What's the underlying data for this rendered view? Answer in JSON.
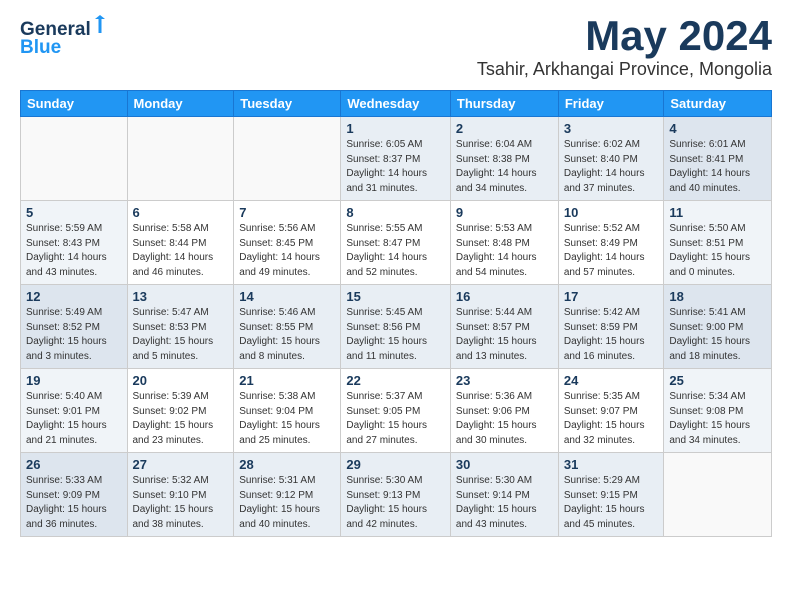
{
  "header": {
    "logo_general": "General",
    "logo_blue": "Blue",
    "month": "May 2024",
    "location": "Tsahir, Arkhangai Province, Mongolia"
  },
  "weekdays": [
    "Sunday",
    "Monday",
    "Tuesday",
    "Wednesday",
    "Thursday",
    "Friday",
    "Saturday"
  ],
  "weeks": [
    [
      {
        "day": "",
        "info": ""
      },
      {
        "day": "",
        "info": ""
      },
      {
        "day": "",
        "info": ""
      },
      {
        "day": "1",
        "info": "Sunrise: 6:05 AM\nSunset: 8:37 PM\nDaylight: 14 hours\nand 31 minutes."
      },
      {
        "day": "2",
        "info": "Sunrise: 6:04 AM\nSunset: 8:38 PM\nDaylight: 14 hours\nand 34 minutes."
      },
      {
        "day": "3",
        "info": "Sunrise: 6:02 AM\nSunset: 8:40 PM\nDaylight: 14 hours\nand 37 minutes."
      },
      {
        "day": "4",
        "info": "Sunrise: 6:01 AM\nSunset: 8:41 PM\nDaylight: 14 hours\nand 40 minutes."
      }
    ],
    [
      {
        "day": "5",
        "info": "Sunrise: 5:59 AM\nSunset: 8:43 PM\nDaylight: 14 hours\nand 43 minutes."
      },
      {
        "day": "6",
        "info": "Sunrise: 5:58 AM\nSunset: 8:44 PM\nDaylight: 14 hours\nand 46 minutes."
      },
      {
        "day": "7",
        "info": "Sunrise: 5:56 AM\nSunset: 8:45 PM\nDaylight: 14 hours\nand 49 minutes."
      },
      {
        "day": "8",
        "info": "Sunrise: 5:55 AM\nSunset: 8:47 PM\nDaylight: 14 hours\nand 52 minutes."
      },
      {
        "day": "9",
        "info": "Sunrise: 5:53 AM\nSunset: 8:48 PM\nDaylight: 14 hours\nand 54 minutes."
      },
      {
        "day": "10",
        "info": "Sunrise: 5:52 AM\nSunset: 8:49 PM\nDaylight: 14 hours\nand 57 minutes."
      },
      {
        "day": "11",
        "info": "Sunrise: 5:50 AM\nSunset: 8:51 PM\nDaylight: 15 hours\nand 0 minutes."
      }
    ],
    [
      {
        "day": "12",
        "info": "Sunrise: 5:49 AM\nSunset: 8:52 PM\nDaylight: 15 hours\nand 3 minutes."
      },
      {
        "day": "13",
        "info": "Sunrise: 5:47 AM\nSunset: 8:53 PM\nDaylight: 15 hours\nand 5 minutes."
      },
      {
        "day": "14",
        "info": "Sunrise: 5:46 AM\nSunset: 8:55 PM\nDaylight: 15 hours\nand 8 minutes."
      },
      {
        "day": "15",
        "info": "Sunrise: 5:45 AM\nSunset: 8:56 PM\nDaylight: 15 hours\nand 11 minutes."
      },
      {
        "day": "16",
        "info": "Sunrise: 5:44 AM\nSunset: 8:57 PM\nDaylight: 15 hours\nand 13 minutes."
      },
      {
        "day": "17",
        "info": "Sunrise: 5:42 AM\nSunset: 8:59 PM\nDaylight: 15 hours\nand 16 minutes."
      },
      {
        "day": "18",
        "info": "Sunrise: 5:41 AM\nSunset: 9:00 PM\nDaylight: 15 hours\nand 18 minutes."
      }
    ],
    [
      {
        "day": "19",
        "info": "Sunrise: 5:40 AM\nSunset: 9:01 PM\nDaylight: 15 hours\nand 21 minutes."
      },
      {
        "day": "20",
        "info": "Sunrise: 5:39 AM\nSunset: 9:02 PM\nDaylight: 15 hours\nand 23 minutes."
      },
      {
        "day": "21",
        "info": "Sunrise: 5:38 AM\nSunset: 9:04 PM\nDaylight: 15 hours\nand 25 minutes."
      },
      {
        "day": "22",
        "info": "Sunrise: 5:37 AM\nSunset: 9:05 PM\nDaylight: 15 hours\nand 27 minutes."
      },
      {
        "day": "23",
        "info": "Sunrise: 5:36 AM\nSunset: 9:06 PM\nDaylight: 15 hours\nand 30 minutes."
      },
      {
        "day": "24",
        "info": "Sunrise: 5:35 AM\nSunset: 9:07 PM\nDaylight: 15 hours\nand 32 minutes."
      },
      {
        "day": "25",
        "info": "Sunrise: 5:34 AM\nSunset: 9:08 PM\nDaylight: 15 hours\nand 34 minutes."
      }
    ],
    [
      {
        "day": "26",
        "info": "Sunrise: 5:33 AM\nSunset: 9:09 PM\nDaylight: 15 hours\nand 36 minutes."
      },
      {
        "day": "27",
        "info": "Sunrise: 5:32 AM\nSunset: 9:10 PM\nDaylight: 15 hours\nand 38 minutes."
      },
      {
        "day": "28",
        "info": "Sunrise: 5:31 AM\nSunset: 9:12 PM\nDaylight: 15 hours\nand 40 minutes."
      },
      {
        "day": "29",
        "info": "Sunrise: 5:30 AM\nSunset: 9:13 PM\nDaylight: 15 hours\nand 42 minutes."
      },
      {
        "day": "30",
        "info": "Sunrise: 5:30 AM\nSunset: 9:14 PM\nDaylight: 15 hours\nand 43 minutes."
      },
      {
        "day": "31",
        "info": "Sunrise: 5:29 AM\nSunset: 9:15 PM\nDaylight: 15 hours\nand 45 minutes."
      },
      {
        "day": "",
        "info": ""
      }
    ]
  ]
}
